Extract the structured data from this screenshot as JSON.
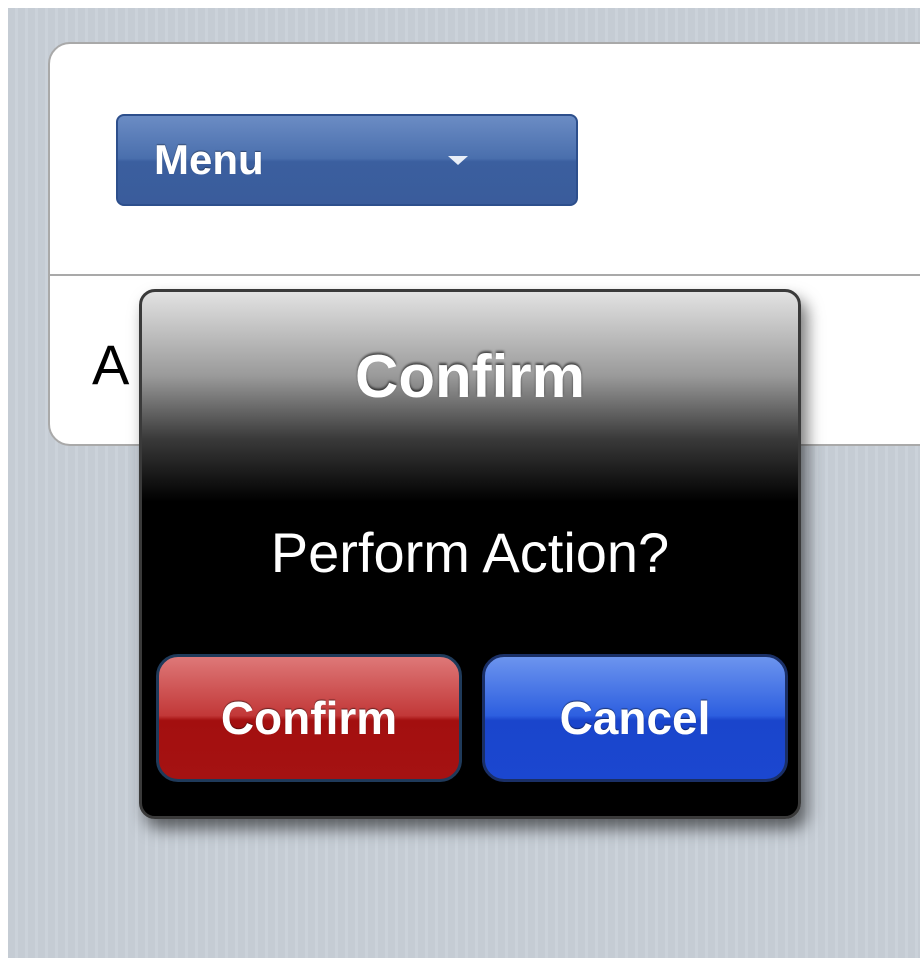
{
  "menu": {
    "label": "Menu",
    "caret_icon": "caret-down-icon"
  },
  "content": {
    "visible_text": "A"
  },
  "dialog": {
    "title": "Confirm",
    "message": "Perform Action?",
    "confirm_label": "Confirm",
    "cancel_label": "Cancel"
  },
  "colors": {
    "menu_button": "#4a6fad",
    "confirm_button": "#a30f0f",
    "cancel_button": "#1a45cc",
    "dialog_background": "#000000",
    "page_background": "#c5ccd4"
  }
}
